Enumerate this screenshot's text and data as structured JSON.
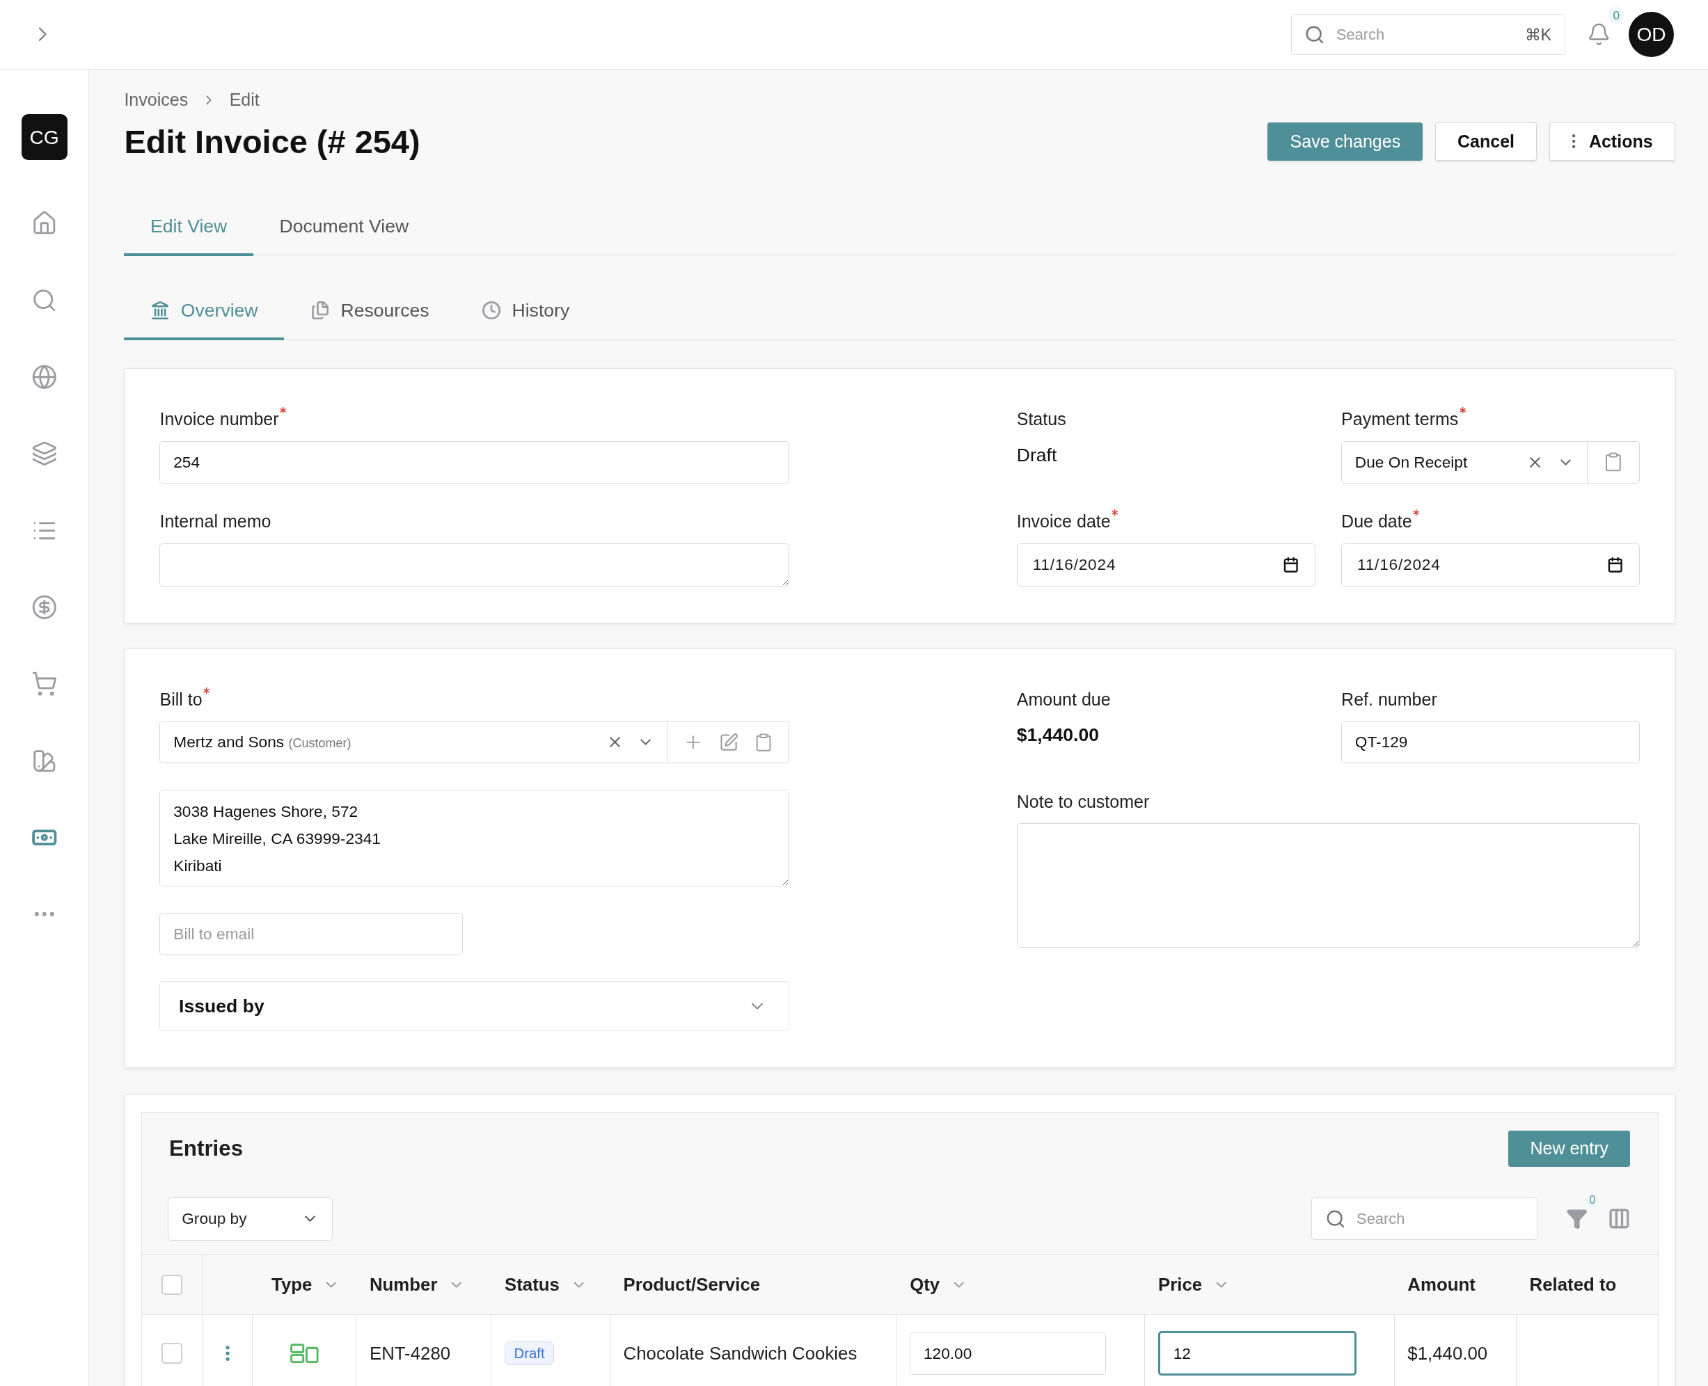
{
  "topbar": {
    "search": {
      "placeholder": "Search",
      "shortcut": "⌘K"
    },
    "notification_count": "0",
    "avatar": "OD"
  },
  "sidebar": {
    "logo": "CG",
    "items": [
      {
        "selected": false
      },
      {
        "selected": false
      },
      {
        "selected": false
      },
      {
        "selected": false
      },
      {
        "selected": false
      },
      {
        "selected": false
      },
      {
        "selected": false
      },
      {
        "selected": false
      },
      {
        "selected": true
      },
      {
        "selected": false
      }
    ]
  },
  "breadcrumb": [
    "Invoices",
    "Edit"
  ],
  "title": "Edit Invoice (# 254)",
  "actions": [
    {
      "label": "Save changes",
      "kind": "primary"
    },
    {
      "label": "Cancel",
      "kind": "secondary"
    },
    {
      "label": "Actions",
      "kind": "menu"
    }
  ],
  "view_tabs": [
    {
      "label": "Edit View",
      "selected": true
    },
    {
      "label": "Document View",
      "selected": false
    }
  ],
  "section_tabs": [
    {
      "label": "Overview",
      "selected": true
    },
    {
      "label": "Resources",
      "selected": false
    },
    {
      "label": "History",
      "selected": false
    }
  ],
  "details": {
    "invoice_number": {
      "label": "Invoice number",
      "required": true,
      "value": "254"
    },
    "internal_memo": {
      "label": "Internal memo",
      "required": false
    },
    "status": {
      "label": "Status",
      "value": "Draft"
    },
    "payment_terms": {
      "label": "Payment terms",
      "required": true,
      "value": "Due On Receipt"
    },
    "invoice_date": {
      "label": "Invoice date",
      "required": true,
      "value": "11/16/2024"
    },
    "due_date": {
      "label": "Due date",
      "required": true,
      "value": "11/16/2024"
    }
  },
  "billing": {
    "bill_to": {
      "label": "Bill to",
      "required": true,
      "value": "Mertz and Sons",
      "tag": "(Customer)"
    },
    "address": "3038 Hagenes Shore, 572\nLake Mireille, CA 63999-2341\nKiribati",
    "email": {
      "placeholder": "Bill to email"
    },
    "issued_by": {
      "label": "Issued by",
      "expanded": false
    },
    "amount_due": {
      "label": "Amount due",
      "value": "$1,440.00"
    },
    "ref_number": {
      "label": "Ref. number",
      "value": "QT-129"
    },
    "note": {
      "label": "Note to customer"
    }
  },
  "entries": {
    "title": "Entries",
    "new_entry": "New entry",
    "group_by": "Group by",
    "search_placeholder": "Search",
    "filter_count": "0",
    "select_all": false,
    "columns": [
      {
        "label": "Type",
        "sortable": true
      },
      {
        "label": "Number",
        "sortable": true
      },
      {
        "label": "Status",
        "sortable": true
      },
      {
        "label": "Product/Service",
        "sortable": false
      },
      {
        "label": "Qty",
        "sortable": true
      },
      {
        "label": "Price",
        "sortable": true
      },
      {
        "label": "Amount",
        "sortable": false
      },
      {
        "label": "Related to",
        "sortable": false
      }
    ],
    "rows": [
      {
        "selected": false,
        "number": "ENT-4280",
        "status": "Draft",
        "product": "Chocolate Sandwich Cookies",
        "qty": "120.00",
        "price": "12",
        "price_focused": true,
        "amount": "$1,440.00"
      }
    ]
  }
}
